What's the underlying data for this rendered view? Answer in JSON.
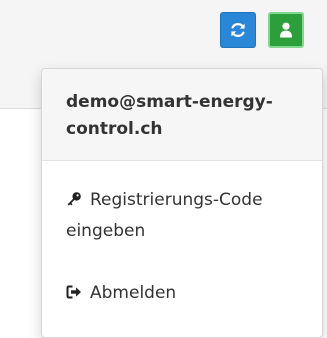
{
  "toolbar": {
    "refresh_icon": "refresh-icon",
    "user_icon": "user-icon",
    "refresh_color": "#2a86d6",
    "user_color": "#2c9f3c"
  },
  "user_menu": {
    "email": "demo@smart-energy-control.ch",
    "items": [
      {
        "icon": "key-icon",
        "label": "Registrierungs-Code eingeben"
      },
      {
        "icon": "sign-out-icon",
        "label": "Abmelden"
      }
    ]
  }
}
